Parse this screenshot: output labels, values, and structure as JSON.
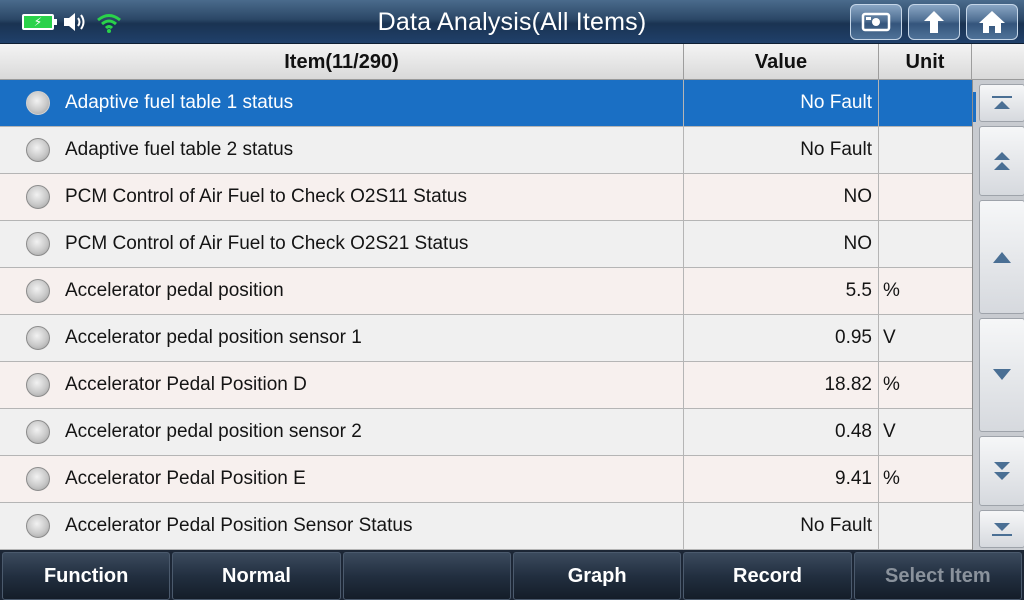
{
  "title": "Data Analysis(All Items)",
  "header": {
    "item": "Item(11/290)",
    "value": "Value",
    "unit": "Unit"
  },
  "rows": [
    {
      "name": "Adaptive fuel table 1 status",
      "value": "No Fault",
      "unit": "",
      "selected": true
    },
    {
      "name": "Adaptive fuel table 2 status",
      "value": "No Fault",
      "unit": ""
    },
    {
      "name": "PCM Control of Air Fuel to Check O2S11 Status",
      "value": "NO",
      "unit": ""
    },
    {
      "name": "PCM Control of Air Fuel to Check O2S21 Status",
      "value": "NO",
      "unit": ""
    },
    {
      "name": "Accelerator pedal position",
      "value": "5.5",
      "unit": "%"
    },
    {
      "name": "Accelerator pedal position sensor 1",
      "value": "0.95",
      "unit": "V"
    },
    {
      "name": "Accelerator Pedal Position D",
      "value": "18.82",
      "unit": "%"
    },
    {
      "name": "Accelerator pedal position sensor 2",
      "value": "0.48",
      "unit": "V"
    },
    {
      "name": "Accelerator Pedal Position E",
      "value": "9.41",
      "unit": "%"
    },
    {
      "name": "Accelerator Pedal Position Sensor Status",
      "value": "No Fault",
      "unit": ""
    }
  ],
  "bottom": {
    "function": "Function",
    "normal": "Normal",
    "empty": "",
    "graph": "Graph",
    "record": "Record",
    "select_item": "Select Item"
  },
  "icons": {
    "battery": "battery-charging-icon",
    "volume": "speaker-icon",
    "wifi": "wifi-icon",
    "screenshot": "screenshot-icon",
    "back": "back-arrow-icon",
    "home": "home-icon"
  },
  "colors": {
    "selected_row": "#1a6fc4",
    "battery": "#2ad24a",
    "wifi": "#2ad24a"
  }
}
